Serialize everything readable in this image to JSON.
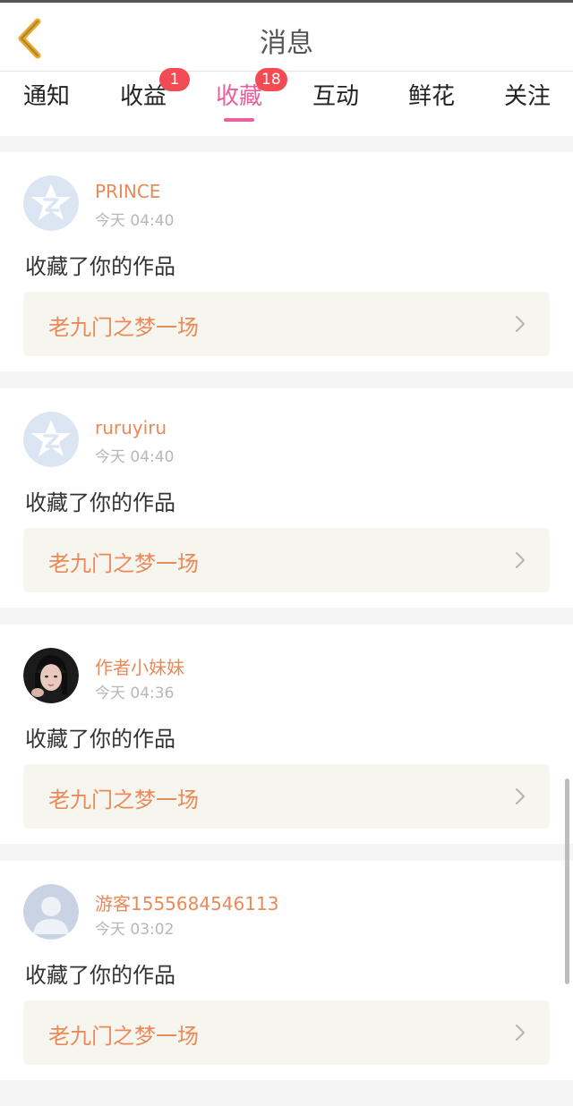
{
  "header": {
    "title": "消息",
    "back_icon": "chevron-left-icon",
    "back_color": "#e7a92b"
  },
  "tabs": [
    {
      "label": "通知",
      "badge": "",
      "active": false
    },
    {
      "label": "收益",
      "badge": "1",
      "active": false
    },
    {
      "label": "收藏",
      "badge": "18",
      "active": true
    },
    {
      "label": "互动",
      "badge": "",
      "active": false
    },
    {
      "label": "鲜花",
      "badge": "",
      "active": false
    },
    {
      "label": "关注",
      "badge": "",
      "active": false
    }
  ],
  "colors": {
    "accent": "#ea5f9d",
    "badge": "#f24b54",
    "name": "#e98a5a"
  },
  "feed": [
    {
      "user": "PRINCE",
      "time": "今天 04:40",
      "action": "收藏了你的作品",
      "work": "老九门之梦一场",
      "avatar": "qq-default-avatar"
    },
    {
      "user": "ruruyiru",
      "time": "今天 04:40",
      "action": "收藏了你的作品",
      "work": "老九门之梦一场",
      "avatar": "qq-default-avatar"
    },
    {
      "user": "作者小妹妹",
      "time": "今天 04:36",
      "action": "收藏了你的作品",
      "work": "老九门之梦一场",
      "avatar": "user-photo-avatar"
    },
    {
      "user": "游客1555684546113",
      "time": "今天 03:02",
      "action": "收藏了你的作品",
      "work": "老九门之梦一场",
      "avatar": "guest-default-avatar"
    }
  ]
}
